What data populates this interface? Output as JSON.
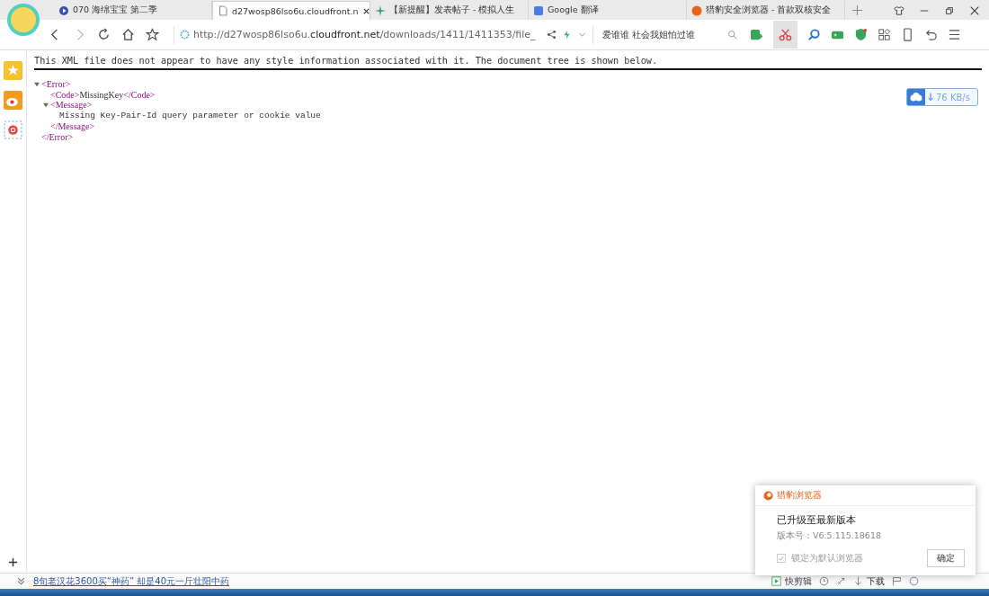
{
  "tabs": [
    {
      "title": "070 海绵宝宝 第二季",
      "selected": false
    },
    {
      "title": "d27wosp86lso6u.cloudfront.n",
      "selected": true
    },
    {
      "title": "【新提醒】发表帖子 - 模拟人生",
      "selected": false
    },
    {
      "title": "Google 翻译",
      "selected": false
    },
    {
      "title": "猎豹安全浏览器 - 首款双核安全",
      "selected": false
    }
  ],
  "address": {
    "parts": [
      {
        "text": "http://d27wosp86lso6u.",
        "kind": "dim"
      },
      {
        "text": "cloudfront.net",
        "kind": "host"
      },
      {
        "text": "/downloads/1411/1411353/file_",
        "kind": "dim"
      }
    ]
  },
  "search": {
    "value": "爱谁谁 社会我姐怕过谁"
  },
  "document": {
    "notice": "This XML file does not appear to have any style information associated with it. The document tree is shown below.",
    "tree": [
      {
        "kind": "element",
        "open": "<Error>",
        "close": "</Error>",
        "expanded": true,
        "children": [
          {
            "kind": "inline",
            "open": "<Code>",
            "text": "MissingKey",
            "close": "</Code>"
          },
          {
            "kind": "element",
            "open": "<Message>",
            "close": "</Message>",
            "expanded": true,
            "children": [
              {
                "kind": "text",
                "text": "Missing Key-Pair-Id query parameter or cookie value"
              }
            ]
          }
        ]
      }
    ]
  },
  "speed": {
    "reading": "76 KB/s"
  },
  "popup": {
    "app": "猎豹浏览器",
    "heading": "已升级至最新版本",
    "version": "版本号：V6.5.115.18618",
    "checkbox": {
      "label": "锁定为默认浏览器",
      "checked": true
    },
    "button": "确定"
  },
  "status_bar": {
    "news": "8旬老汉花3600买“神药” 却是40元一斤壮阳中药",
    "clip": "快剪辑",
    "download": "下载"
  }
}
